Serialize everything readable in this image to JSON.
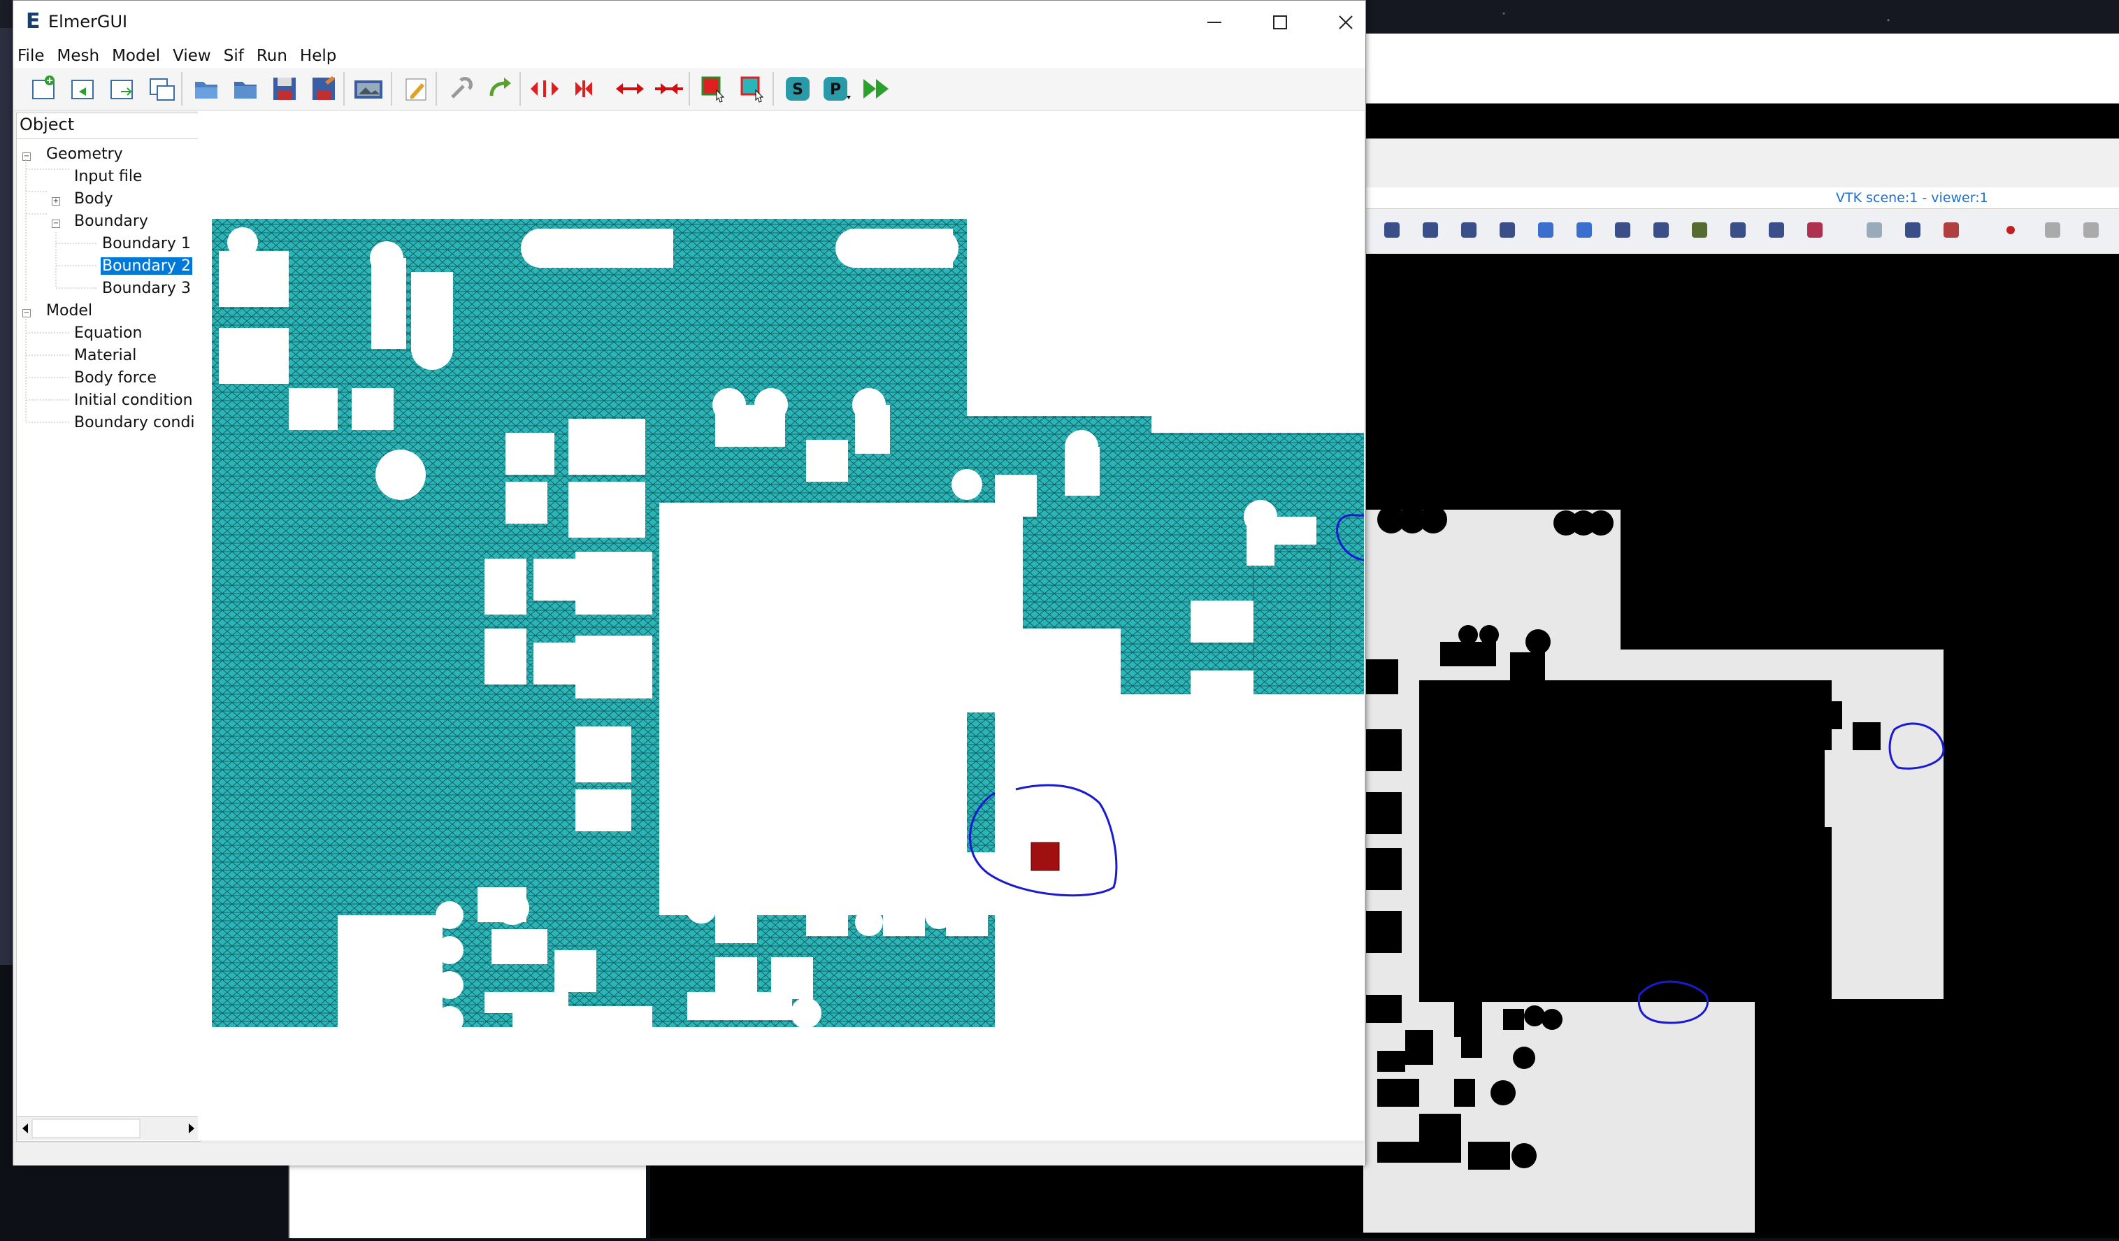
{
  "window": {
    "title": "ElmerGUI",
    "app_letter": "E"
  },
  "menu": [
    "File",
    "Mesh",
    "Model",
    "View",
    "Sif",
    "Run",
    "Help"
  ],
  "toolbar": {
    "icons": [
      "new-file-icon",
      "new-geometry-icon",
      "open-file-icon",
      "duplicate-icon",
      "open-folder-icon",
      "open-folder-2-icon",
      "save-icon",
      "save-as-icon",
      "screenshot-icon",
      "edit-icon",
      "remesh-icon",
      "redo-icon",
      "divide-surface-icon",
      "unify-surface-icon",
      "divide-edge-icon",
      "unify-edge-icon",
      "select-icon",
      "select-box-icon",
      "solver-input-icon",
      "post-process-icon",
      "run-icon"
    ]
  },
  "sidebar": {
    "header": "Object",
    "tree": [
      {
        "label": "Geometry",
        "level": 0,
        "expander": "−"
      },
      {
        "label": "Input file",
        "level": 1
      },
      {
        "label": "Body",
        "level": 1,
        "expander": "+"
      },
      {
        "label": "Boundary",
        "level": 1,
        "expander": "−"
      },
      {
        "label": "Boundary 1",
        "level": 2
      },
      {
        "label": "Boundary 2",
        "level": 2,
        "selected": true
      },
      {
        "label": "Boundary 3",
        "level": 2
      },
      {
        "label": "Model",
        "level": 0,
        "expander": "−"
      },
      {
        "label": "Equation",
        "level": 1
      },
      {
        "label": "Material",
        "level": 1
      },
      {
        "label": "Body force",
        "level": 1
      },
      {
        "label": "Initial condition",
        "level": 1
      },
      {
        "label": "Boundary condi",
        "level": 1
      }
    ]
  },
  "viewer": {
    "title": "VTK scene:1 - viewer:1"
  },
  "colors": {
    "mesh": "#2ab6b8",
    "selected_boundary": "#a01010",
    "annotation": "#1a1ad0",
    "selection": "#0078d7"
  }
}
